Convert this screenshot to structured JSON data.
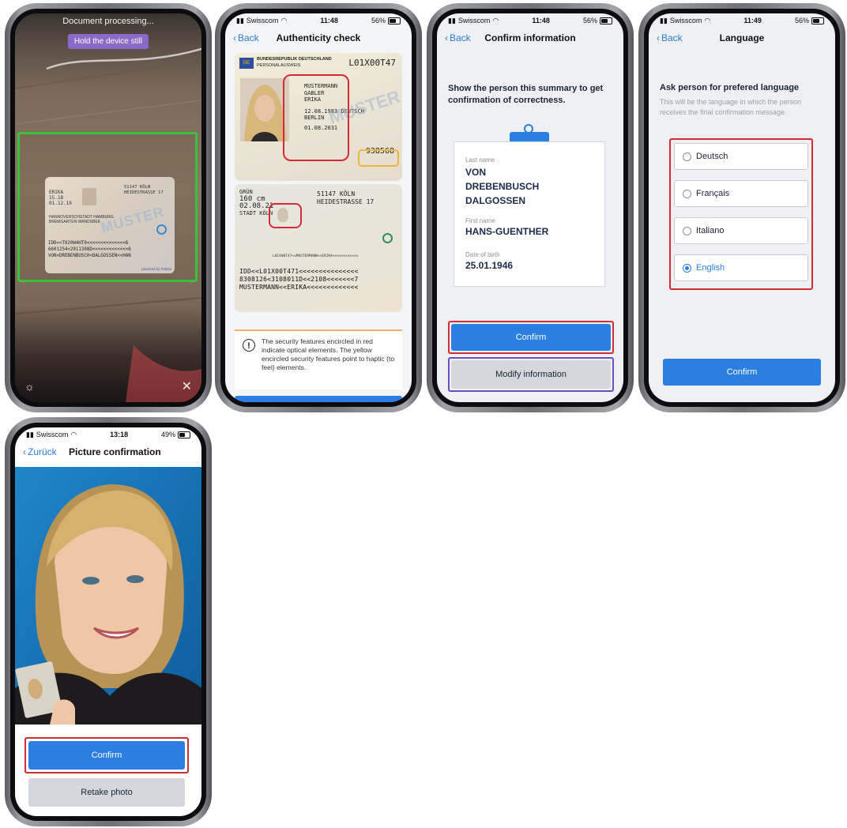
{
  "colors": {
    "accent": "#2b7fe2",
    "highlight_red": "#d42a36",
    "highlight_purple": "#6a4fc2",
    "highlight_green": "#39c13d",
    "highlight_yellow": "#e8b63a"
  },
  "screen1": {
    "processing_text": "Document processing...",
    "hint_badge": "Hold the device still",
    "card": {
      "name_lines": [
        "ERIKA",
        "15.18",
        "01.12.19"
      ],
      "address_lines": [
        "51147 KÖLN",
        "HEIDESTRASSE 17"
      ],
      "city_lines": [
        "HANNOVERSCHSTADT HAMBURG",
        "BREMGARTEN WANDSBEK"
      ],
      "watermark": "MUSTER",
      "mrz": [
        "IDD<<T020W4HT0<<<<<<<<<<<<<<6",
        "6601254<2911308D<<<<<<<<<<<<<6",
        "VON<DREBENBUSCH<DALGOSSEN<<HAN"
      ],
      "powered": "powered by Fidelia"
    },
    "icons": {
      "brightness": "sun-icon",
      "close": "close-icon"
    }
  },
  "screen2": {
    "status": {
      "carrier": "Swisscom",
      "time": "11:48",
      "battery": "56%"
    },
    "back": "Back",
    "title": "Authenticity check",
    "id_front": {
      "country": "BUNDESREPUBLIK DEUTSCHLAND",
      "doc": "PERSONALAUSWEIS",
      "number": "L01X00T47",
      "surname": "MUSTERMANN",
      "birth_name": "GABLER",
      "given": "ERIKA",
      "dob": "12.08.1983",
      "nationality": "DEUTSCH",
      "birthplace": "BERLIN",
      "expiry": "01.08.2031",
      "can": "938568",
      "watermark": "MUSTER"
    },
    "id_back": {
      "eyes": "GRÜN",
      "height": "160 cm",
      "issued": "02.08.21",
      "authority": "STADT KÖLN",
      "address1": "51147 KÖLN",
      "address2": "HEIDESTRASSE 17",
      "code_line": "L01X00T47<<MUSTERMANN<<ERIKA<<<<<<<<<<<<",
      "mrz": [
        "IDD<<L01X00T471<<<<<<<<<<<<<<<",
        "8308126<3108011D<<2108<<<<<<<7",
        "MUSTERMANN<<ERIKA<<<<<<<<<<<<<"
      ]
    },
    "info_text": "The security features encircled in red indicate optical elements. The yellow encircled security features point to haptic (to feel) elements."
  },
  "screen3": {
    "status": {
      "carrier": "Swisscom",
      "time": "11:48",
      "battery": "56%"
    },
    "back": "Back",
    "title": "Confirm information",
    "heading": "Show the person this summary to get confirmation of correctness.",
    "fields": [
      {
        "label": "Last name",
        "value": "VON DREBENBUSCH DALGOSSEN"
      },
      {
        "label": "First name",
        "value": "HANS-GUENTHER"
      },
      {
        "label": "Date of birth",
        "value": "25.01.1946"
      }
    ],
    "confirm": "Confirm",
    "modify": "Modify information"
  },
  "screen4": {
    "status": {
      "carrier": "Swisscom",
      "time": "11:49",
      "battery": "56%"
    },
    "back": "Back",
    "title": "Language",
    "heading": "Ask person for prefered language",
    "subtext": "This will be the language in which the person receives the final confirmation message.",
    "options": [
      "Deutsch",
      "Français",
      "Italiano",
      "English"
    ],
    "selected": "English",
    "confirm": "Confirm"
  },
  "screen5": {
    "status": {
      "carrier": "Swisscom",
      "time": "13:18",
      "battery": "49%"
    },
    "back": "Zurück",
    "title": "Picture confirmation",
    "confirm": "Confirm",
    "retake": "Retake photo"
  }
}
